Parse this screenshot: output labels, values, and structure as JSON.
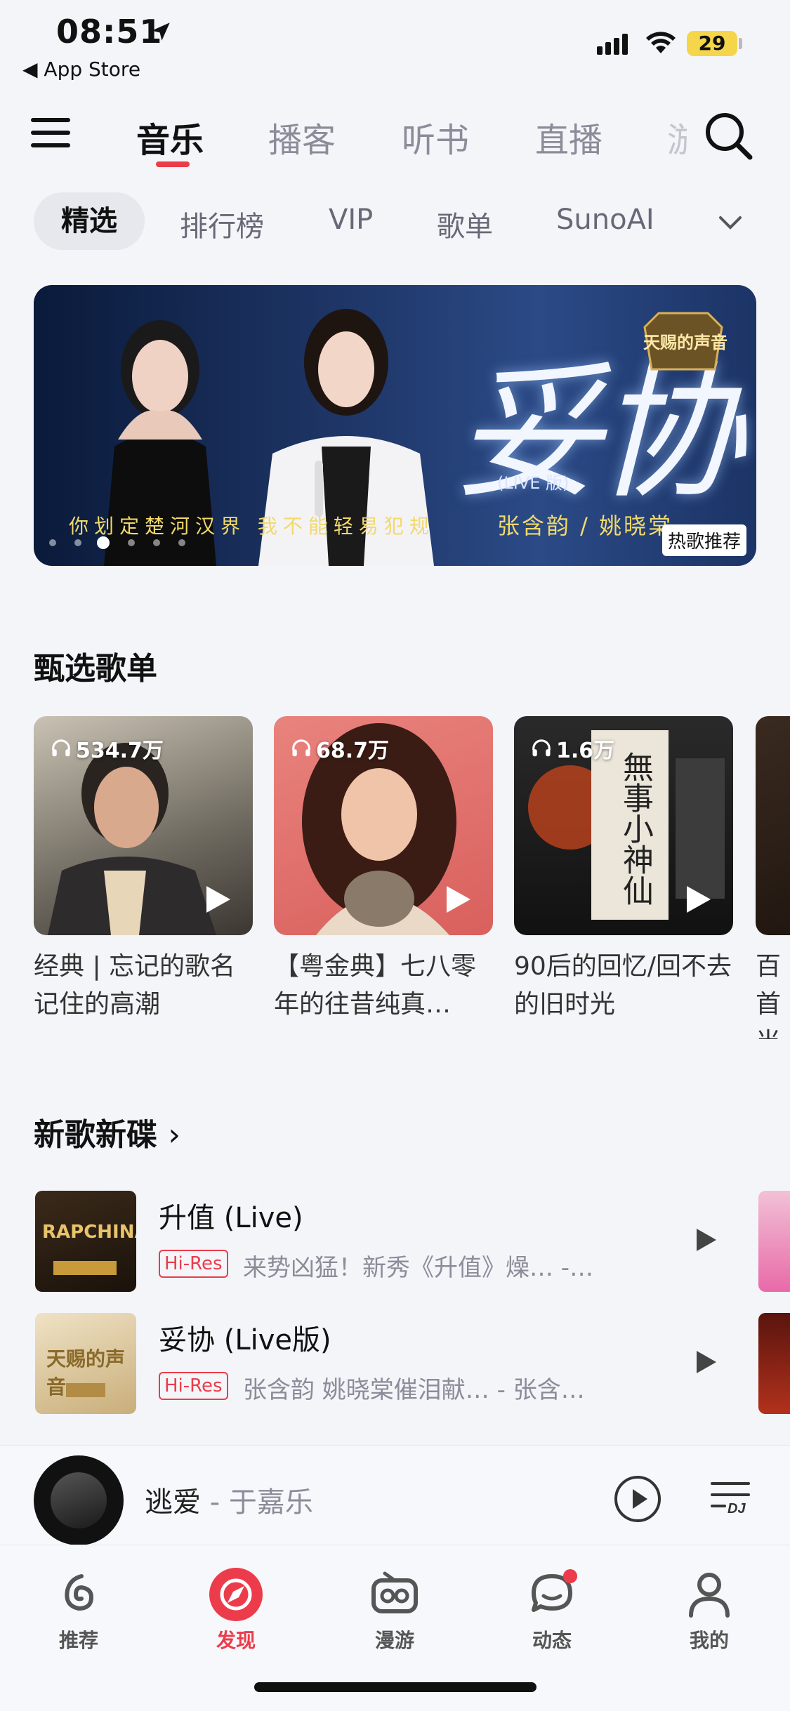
{
  "status_bar": {
    "time": "08:51",
    "back_label": "◀ App Store",
    "battery": "29"
  },
  "top_tabs": [
    "音乐",
    "播客",
    "听书",
    "直播",
    "游"
  ],
  "sub_tabs": [
    "精选",
    "排行榜",
    "VIP",
    "歌单",
    "SunoAI"
  ],
  "banner": {
    "title": "妥协",
    "version": "(LIVE 版)",
    "lyrics": "你划定楚河汉界 我不能轻易犯规",
    "artists": "张含韵 / 姚晓棠",
    "badge": "热歌推荐",
    "logo_text": "天赐的声音",
    "page_count": 6,
    "active_index": 2
  },
  "curated": {
    "title": "甄选歌单",
    "playlists": [
      {
        "count": "534.7万",
        "title": "经典 | 忘记的歌名记住的高潮"
      },
      {
        "count": "68.7万",
        "title": "【粤金典】七八零年的往昔纯真…"
      },
      {
        "count": "1.6万",
        "title": "90后的回忆/回不去的旧时光"
      },
      {
        "count": "",
        "title": "百首当红"
      }
    ]
  },
  "new_songs": {
    "title": "新歌新碟",
    "items": [
      {
        "title": "升值 (Live)",
        "badge": "Hi-Res",
        "subtitle": "来势凶猛！新秀《升值》燥…  -…"
      },
      {
        "title": "妥协 (Live版)",
        "badge": "Hi-Res",
        "subtitle": "张含韵 姚晓棠催泪献…   - 张含…"
      }
    ]
  },
  "mini_player": {
    "song": "逃爱",
    "artist": " - 于嘉乐"
  },
  "bottom_nav": [
    "推荐",
    "发现",
    "漫游",
    "动态",
    "我的"
  ],
  "colors": {
    "accent": "#ec3c4b",
    "background": "#f4f5f9"
  }
}
